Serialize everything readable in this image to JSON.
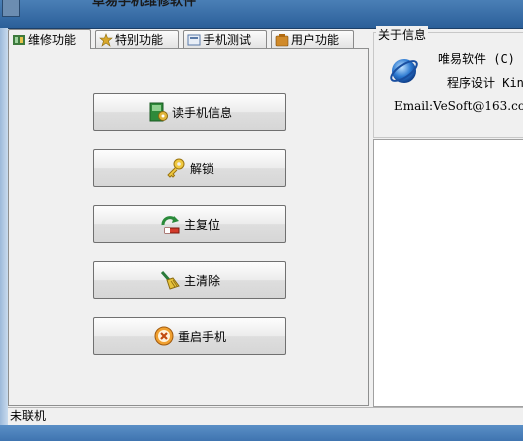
{
  "window": {
    "title": "卓易手机维修软件"
  },
  "tabs": [
    {
      "label": "维修功能",
      "icon": "wrench-icon",
      "active": true
    },
    {
      "label": "特别功能",
      "icon": "star-tool-icon",
      "active": false
    },
    {
      "label": "手机测试",
      "icon": "phone-test-icon",
      "active": false
    },
    {
      "label": "用户功能",
      "icon": "user-tools-icon",
      "active": false
    }
  ],
  "buttons": [
    {
      "label": "读手机信息",
      "icon": "chip-gear-icon"
    },
    {
      "label": "解锁",
      "icon": "key-icon"
    },
    {
      "label": "主复位",
      "icon": "reset-arrow-icon"
    },
    {
      "label": "主清除",
      "icon": "broom-icon"
    },
    {
      "label": "重启手机",
      "icon": "restart-x-icon"
    }
  ],
  "about": {
    "legend": "关于信息",
    "line1": "唯易软件 (C)",
    "line2": "程序设计 Kin",
    "line3": "Email:VeSoft@163.co",
    "icon": "globe-icon"
  },
  "status": {
    "text": "未联机"
  },
  "colors": {
    "accent": "#2b5f99",
    "button_border": "#707070"
  }
}
